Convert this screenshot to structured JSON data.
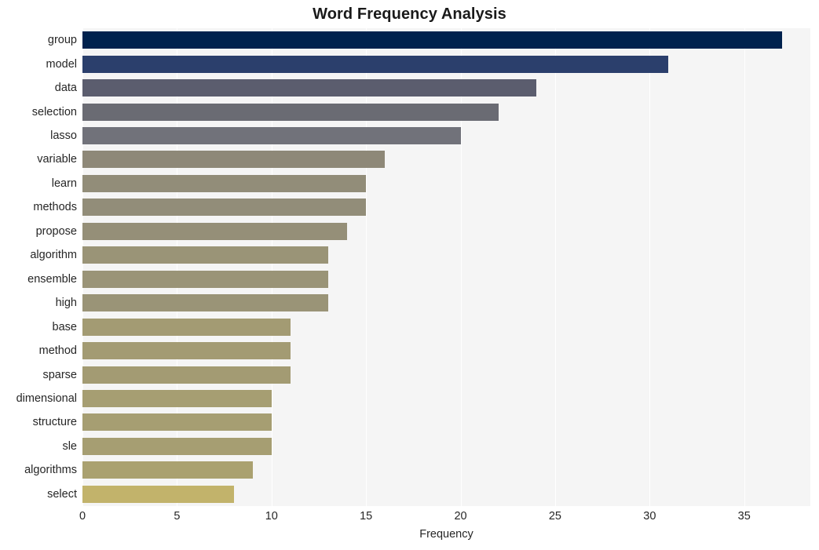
{
  "chart_data": {
    "type": "bar",
    "orientation": "horizontal",
    "title": "Word Frequency Analysis",
    "xlabel": "Frequency",
    "ylabel": "",
    "categories": [
      "group",
      "model",
      "data",
      "selection",
      "lasso",
      "variable",
      "learn",
      "methods",
      "propose",
      "algorithm",
      "ensemble",
      "high",
      "base",
      "method",
      "sparse",
      "dimensional",
      "structure",
      "sle",
      "algorithms",
      "select"
    ],
    "values": [
      37,
      31,
      24,
      22,
      20,
      16,
      15,
      15,
      14,
      13,
      13,
      13,
      11,
      11,
      11,
      10,
      10,
      10,
      9,
      8
    ],
    "bar_colors": [
      "#00224e",
      "#2b3f6c",
      "#5b5d6e",
      "#6a6b73",
      "#71727a",
      "#8e8878",
      "#928d79",
      "#928d79",
      "#958f78",
      "#9a9477",
      "#9a9477",
      "#9a9477",
      "#a39b73",
      "#a39b73",
      "#a39b73",
      "#a69e72",
      "#a69e72",
      "#a69e72",
      "#aaa170",
      "#c2b36b"
    ],
    "xticks": [
      0,
      5,
      10,
      15,
      20,
      25,
      30,
      35
    ],
    "xtick_labels": [
      "0",
      "5",
      "10",
      "15",
      "20",
      "25",
      "30",
      "35"
    ],
    "xlim": [
      0,
      38.5
    ],
    "grid": true,
    "grid_axis": "x",
    "grid_color": "#ffffff",
    "plot_background": "#f5f5f5",
    "figure_background": "#ffffff",
    "legend": null,
    "colormap": "cividis"
  }
}
